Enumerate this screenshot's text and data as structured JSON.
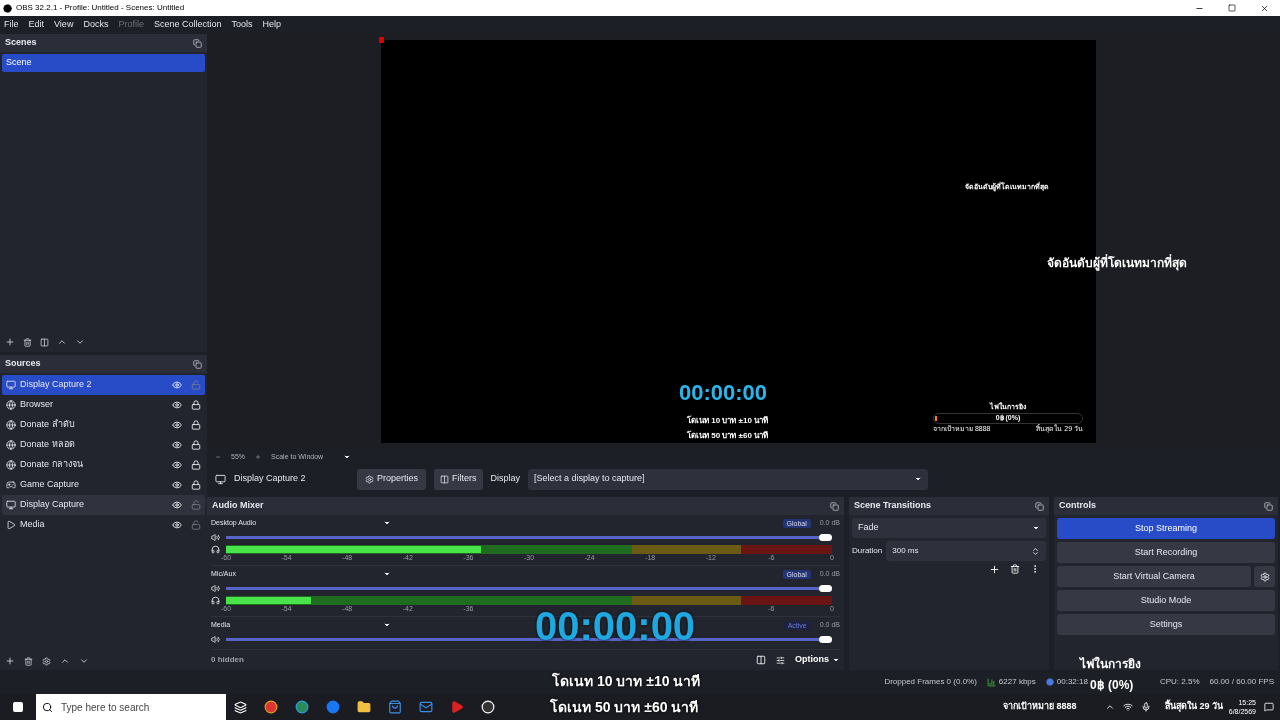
{
  "window": {
    "title": "OBS 32.2.1 - Profile: Untitled - Scenes: Untitled"
  },
  "menu": [
    {
      "label": "File",
      "disabled": false
    },
    {
      "label": "Edit",
      "disabled": false
    },
    {
      "label": "View",
      "disabled": false
    },
    {
      "label": "Docks",
      "disabled": false
    },
    {
      "label": "Profile",
      "disabled": true
    },
    {
      "label": "Scene Collection",
      "disabled": false
    },
    {
      "label": "Tools",
      "disabled": false
    },
    {
      "label": "Help",
      "disabled": false
    }
  ],
  "scenes": {
    "title": "Scenes",
    "items": [
      {
        "name": "Scene",
        "selected": true
      }
    ]
  },
  "sources": {
    "title": "Sources",
    "items": [
      {
        "name": "Display Capture 2",
        "kind": "display",
        "selected": true,
        "hovered": false,
        "locked": false
      },
      {
        "name": "Browser",
        "kind": "browser",
        "selected": false,
        "hovered": false,
        "locked": true
      },
      {
        "name": "Donate ลำดับ",
        "kind": "browser",
        "selected": false,
        "hovered": false,
        "locked": true
      },
      {
        "name": "Donate หลอด",
        "kind": "browser",
        "selected": false,
        "hovered": false,
        "locked": true
      },
      {
        "name": "Donate กลางจน",
        "kind": "browser",
        "selected": false,
        "hovered": false,
        "locked": true
      },
      {
        "name": "Game Capture",
        "kind": "game",
        "selected": false,
        "hovered": false,
        "locked": true
      },
      {
        "name": "Display Capture",
        "kind": "display",
        "selected": false,
        "hovered": true,
        "locked": false
      },
      {
        "name": "Media",
        "kind": "media",
        "selected": false,
        "hovered": false,
        "locked": false
      }
    ]
  },
  "preview": {
    "zoom": "55%",
    "scale_mode": "Scale to Window",
    "leaderboard_small": "จัดอันดับผู้ที่โดเนทมากที่สุด",
    "leaderboard_large": "จัดอันดับผู้ที่โดเนทมากที่สุด",
    "timer": "00:00:00",
    "donate_lines": [
      "โดเนท 10 บาท ±10 นาที",
      "โดเนท 50 บาท ±60 นาที"
    ],
    "goal": {
      "title": "ไฟในการยิง",
      "amount": "0฿ (0%)",
      "level": 0,
      "target": "จากเป้าหมาย 8888",
      "ends": "สิ้นสุดใน 29 วัน"
    }
  },
  "source_toolbar": {
    "source_name": "Display Capture 2",
    "properties": "Properties",
    "filters": "Filters",
    "display_label": "Display",
    "display_value": "[Select a display to capture]"
  },
  "audio_mixer": {
    "title": "Audio Mixer",
    "channels": [
      {
        "name": "Desktop Audio",
        "badge": "Global",
        "badge_highlighted": true,
        "volume": "0.0 dB",
        "slider": {
          "level": 1
        },
        "meter": {
          "level": 0.42,
          "ticks": [
            "-60",
            "-54",
            "-48",
            "-42",
            "-36",
            "-30",
            "-24",
            "-18",
            "-12",
            "-6",
            "0"
          ]
        }
      },
      {
        "name": "Mic/Aux",
        "badge": "Global",
        "badge_highlighted": true,
        "volume": "0.0 dB",
        "slider": {
          "level": 1
        },
        "meter": {
          "level": 0.14,
          "ticks": [
            "-60",
            "-54",
            "-48",
            "-42",
            "-36",
            "-6",
            "0"
          ]
        }
      },
      {
        "name": "Media",
        "badge": "Active",
        "badge_highlighted": false,
        "volume": "0.0 dB",
        "slider": {
          "level": 1
        }
      }
    ],
    "hidden": "0 hidden",
    "options": "Options"
  },
  "scene_transitions": {
    "title": "Scene Transitions",
    "transition": "Fade",
    "duration_label": "Duration",
    "duration": "300 ms"
  },
  "controls": {
    "title": "Controls",
    "buttons": [
      {
        "label": "Stop Streaming",
        "active": true
      },
      {
        "label": "Start Recording",
        "active": false
      },
      {
        "label": "Start Virtual Camera",
        "active": false
      },
      {
        "label": "Studio Mode",
        "active": false
      },
      {
        "label": "Settings",
        "active": false
      }
    ]
  },
  "status_bar": {
    "dropped_frames": "Dropped Frames 0 (0.0%)",
    "bitrate": "6227 kbps",
    "time": "00:32:18",
    "cpu": "CPU: 2.5%",
    "fps": "60.00 / 60.00 FPS"
  },
  "stream_overlay": {
    "timer": "00:00:00",
    "captions": [
      "โดเนท 10 บาท ±10 นาที",
      "โดเนท 50 บาท ±60 นาที"
    ],
    "goal_title": "ไฟในการยิง",
    "goal_amount": "0฿ (0%)",
    "goal_target": "จากเป้าหมาย 8888",
    "goal_ends": "สิ้นสุดใน 29 วัน"
  },
  "taskbar": {
    "search_placeholder": "Type here to search",
    "clock_time": "15:25",
    "clock_date": "6/8/2569"
  }
}
